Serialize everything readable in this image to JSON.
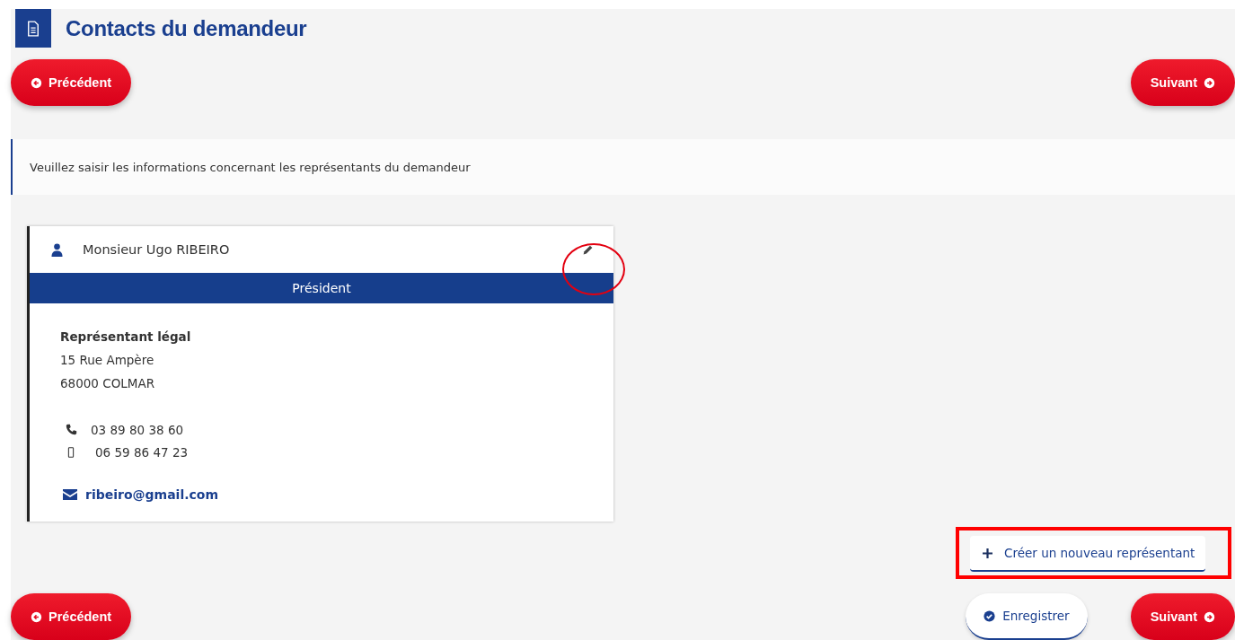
{
  "page_title": "Contacts du demandeur",
  "top_nav": {
    "previous": "Précédent",
    "next": "Suivant"
  },
  "info_message": "Veuillez saisir les informations concernant les représentants du demandeur",
  "representatives": [
    {
      "name": "Monsieur Ugo RIBEIRO",
      "role": "Président",
      "type": "Représentant légal",
      "address_lines": [
        "15 Rue Ampère",
        "68000 COLMAR"
      ],
      "phones": [
        {
          "kind": "landline",
          "number": "03 89 80 38 60"
        },
        {
          "kind": "mobile",
          "number": "06 59 86 47 23"
        }
      ],
      "email": "ribeiro@gmail.com"
    }
  ],
  "create_button": "Créer un nouveau représentant",
  "bottom_nav": {
    "previous": "Précédent",
    "save": "Enregistrer",
    "next": "Suivant"
  }
}
